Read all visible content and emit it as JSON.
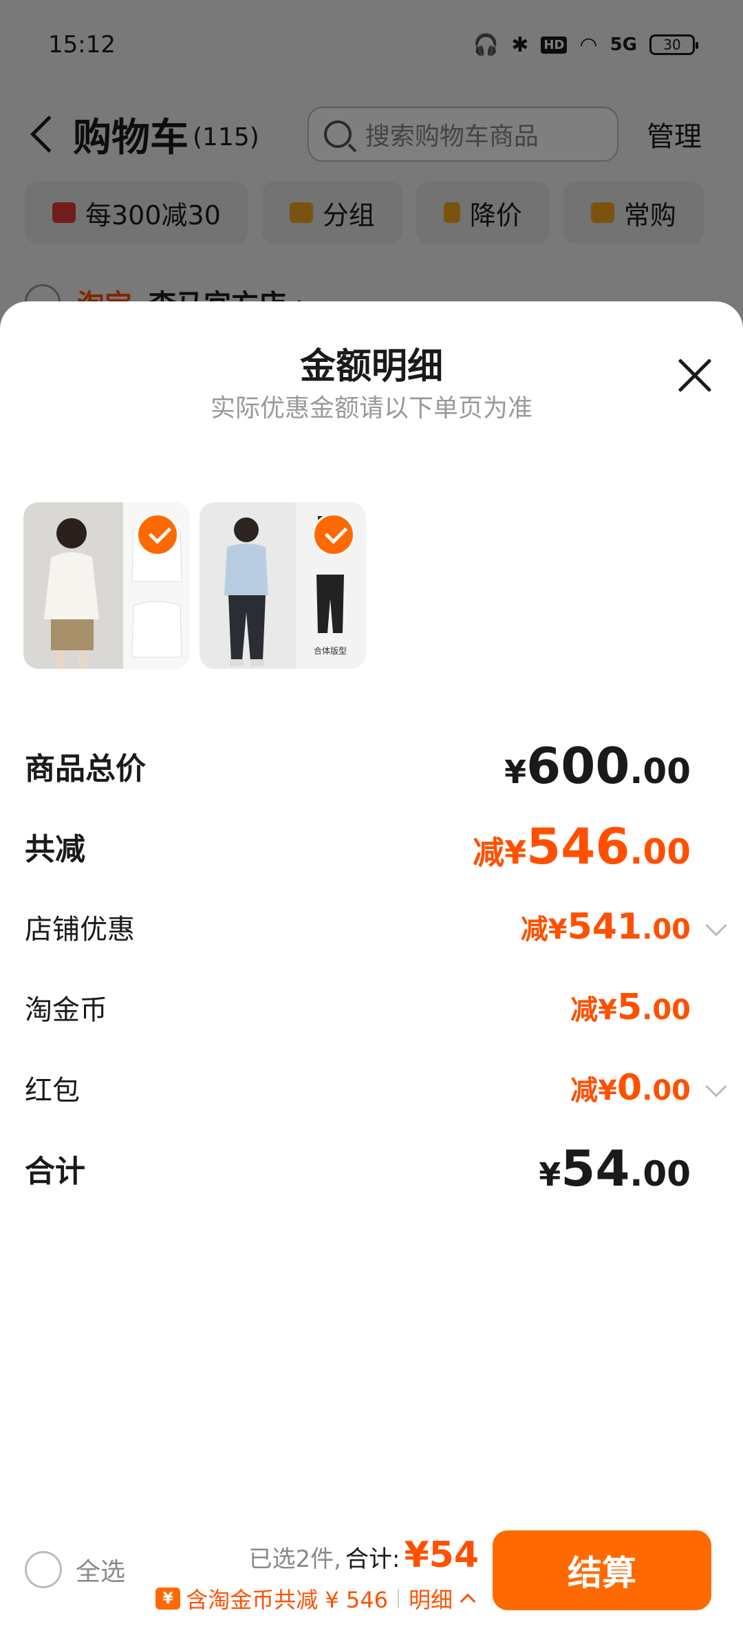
{
  "status_bar": {
    "time": "15:12",
    "hd": "HD",
    "network": "5G",
    "battery": "30"
  },
  "nav": {
    "title": "购物车",
    "count": "(115)",
    "search_placeholder": "搜索购物车商品",
    "manage": "管理"
  },
  "chips": [
    {
      "label": "每300减30",
      "icon": "store-icon",
      "color": "#e4393c"
    },
    {
      "label": "分组",
      "icon": "folder-icon",
      "color": "#f5a623"
    },
    {
      "label": "降价",
      "icon": "price-drop-icon",
      "color": "#f5a623"
    },
    {
      "label": "常购",
      "icon": "cart-icon",
      "color": "#f5a623"
    }
  ],
  "store": {
    "tag": "淘宝",
    "name": "李马宜方店 ›"
  },
  "sheet": {
    "title": "金额明细",
    "subtitle": "实际优惠金额请以下单页为准",
    "thumbnails": [
      {
        "caption": ""
      },
      {
        "caption": "合体版型"
      }
    ],
    "rows": [
      {
        "label": "商品总价",
        "prefix": "¥",
        "int": "600",
        "dec": ".00"
      },
      {
        "label": "共减",
        "prefix": "减¥",
        "int": "546",
        "dec": ".00"
      },
      {
        "label": "店铺优惠",
        "prefix": "减¥",
        "int": "541",
        "dec": ".00"
      },
      {
        "label": "淘金币",
        "prefix": "减¥",
        "int": "5",
        "dec": ".00"
      },
      {
        "label": "红包",
        "prefix": "减¥",
        "int": "0",
        "dec": ".00"
      },
      {
        "label": "合计",
        "prefix": "¥",
        "int": "54",
        "dec": ".00"
      }
    ]
  },
  "bottom_bar": {
    "select_all": "全选",
    "selected_count": "已选2件,",
    "total_label": "合计:",
    "total_value": "¥54",
    "coin_badge": "¥",
    "coin_text": "含淘金币共减 ¥ 546",
    "detail_link": "明细",
    "checkout": "结算"
  },
  "colors": {
    "accent": "#ff5000",
    "button": "#ff6a00"
  }
}
